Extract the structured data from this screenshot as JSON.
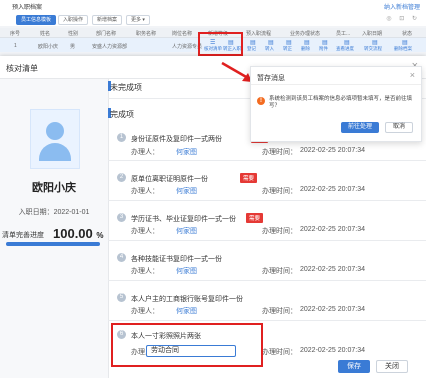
{
  "app": {
    "title": "预入职档案",
    "corner_link": "纳入新档管理",
    "toolbar": [
      "员工信息模板",
      "入职操作",
      "新增档案",
      "更多 ▾"
    ],
    "columns": [
      "序号",
      "姓名",
      "性别",
      "部门名称",
      "职务名称",
      "岗位名称",
      "新增等级",
      "入职日期",
      "入职等级",
      "预入职流程",
      "业务办理状态",
      "员工...",
      "入职日期",
      "状态"
    ],
    "row": [
      "1",
      "欧阳小庆",
      "男",
      "安盛人力资源部",
      "",
      "人力资源专员"
    ],
    "row_actions": [
      "核对清单",
      "转正入职",
      "登记",
      "转入",
      "转正",
      "删除",
      "附件",
      "查看进度",
      "转交流程",
      "删除档案"
    ]
  },
  "dialog": {
    "title": "核对清单",
    "close_icon": "×",
    "employee": {
      "name": "欧阳小庆",
      "hire_date_label": "入职日期：",
      "hire_date": "2022-01-01"
    },
    "progress": {
      "label": "清单完善进度",
      "value_text": "100.00",
      "unit": "%",
      "fraction": 1.0
    },
    "sections": {
      "incomplete": "未完成项",
      "complete": "完成项"
    },
    "items": [
      {
        "num": "1",
        "text": "身份证原件及复印件一式两份",
        "required": "需要",
        "handler_label": "办理人：",
        "handler": "何家图",
        "time_label": "办理时间：",
        "time": "2022-02-25 20:07:34"
      },
      {
        "num": "2",
        "text": "原单位离职证明原件一份",
        "required": "需要",
        "handler_label": "办理人：",
        "handler": "何家图",
        "time_label": "办理时间：",
        "time": "2022-02-25 20:07:34"
      },
      {
        "num": "3",
        "text": "学历证书、毕业证复印件一式一份",
        "required": "需要",
        "handler_label": "办理人：",
        "handler": "何家图",
        "time_label": "办理时间：",
        "time": "2022-02-25 20:07:34"
      },
      {
        "num": "4",
        "text": "各种技能证书复印件一式一份",
        "required": "",
        "handler_label": "办理人：",
        "handler": "何家图",
        "time_label": "办理时间：",
        "time": "2022-02-25 20:07:34"
      },
      {
        "num": "5",
        "text": "本人户主的工商银行账号复印件一份",
        "required": "",
        "handler_label": "办理人：",
        "handler": "何家图",
        "time_label": "办理时间：",
        "time": "2022-02-25 20:07:34"
      },
      {
        "num": "6",
        "text": "本人一寸彩照照片两张",
        "required": "",
        "handler_label": "办理人：",
        "handler": "",
        "input_value": "劳动合同",
        "time_label": "办理时间：",
        "time": "2022-02-25 20:07:34"
      }
    ],
    "buttons": {
      "save": "保存",
      "close": "关闭"
    }
  },
  "warning": {
    "title": "暂存消息",
    "close_icon": "×",
    "icon": "!",
    "message": "系统检测到该员工档案的信息必填项暂未填写，是否前往填写？",
    "confirm": "前往处理",
    "cancel": "取消"
  },
  "colors": {
    "accent": "#3a7bd5",
    "badge": "#e53935",
    "highlight": "#e02020",
    "warning_icon": "#f36c21"
  }
}
